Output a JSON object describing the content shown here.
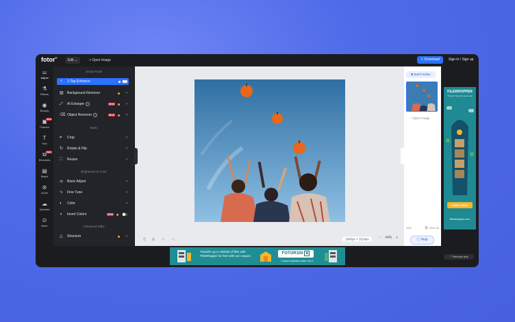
{
  "topbar": {
    "logo": "fotor",
    "edit_label": "Edit ⌄",
    "open_image_label": "+  Open Image",
    "download_label": "⇩ Download",
    "signin_label": "Sign in / Sign up"
  },
  "rail": {
    "items": [
      {
        "label": "Adjust",
        "icon": "sliders-icon"
      },
      {
        "label": "Effects",
        "icon": "flask-icon"
      },
      {
        "label": "Beauty",
        "icon": "eye-icon"
      },
      {
        "label": "Frames",
        "icon": "frame-icon",
        "badge": "NEW"
      },
      {
        "label": "Text",
        "icon": "text-icon"
      },
      {
        "label": "Elements",
        "icon": "elements-icon",
        "badge": "NEW"
      },
      {
        "label": "Batch",
        "icon": "batch-icon"
      },
      {
        "label": "AI Art",
        "icon": "ai-art-icon"
      },
      {
        "label": "Uploads",
        "icon": "cloud-upload-icon"
      },
      {
        "label": "More",
        "icon": "more-icon"
      }
    ]
  },
  "panel": {
    "smart_tools_title": "Smart Tools",
    "basic_title": "Basic",
    "brightness_title": "Brightness & Color",
    "advanced_title": "Advanced Edits",
    "smart_tools": [
      {
        "label": "1-Tap Enhance"
      },
      {
        "label": "Background Remover"
      },
      {
        "label": "AI Enlarger",
        "tag": "NEW"
      },
      {
        "label": "Object Remover",
        "tag": "NEW"
      }
    ],
    "basic": [
      {
        "label": "Crop"
      },
      {
        "label": "Rotate & Flip"
      },
      {
        "label": "Resize"
      }
    ],
    "brightness": [
      {
        "label": "Basic Adjust"
      },
      {
        "label": "Fine Tune"
      },
      {
        "label": "Color"
      },
      {
        "label": "Invert Colors",
        "tag": "NEW"
      }
    ],
    "advanced": [
      {
        "label": "Structure"
      }
    ]
  },
  "canvas": {
    "dimensions": "1080px × 1024px",
    "zoom_value": "44%",
    "zoom_minus": "−",
    "zoom_plus": "+"
  },
  "right_panel": {
    "batch_editor": "⧉ Batch Editor",
    "open_image": "+  Open Image",
    "count": "1/50",
    "clear_all": "🗑 Clear All",
    "help": "ⓘ Help"
  },
  "right_ad": {
    "title": "FILEWHOPPER",
    "subtitle": "Transfer files the smart way",
    "button": "Learn more",
    "url": "filewhopper.com"
  },
  "bottom_ad": {
    "text": "Transfer up to 200GB of files with FileWhopper for free with our coupon",
    "code": "FOTOR100",
    "expiration": "Coupon expiration date: July 1"
  },
  "remove_ads": "♡ Remove ads",
  "colors": {
    "accent": "#2b72ff",
    "background": "#4f6be8",
    "app_dark": "#1b1c20",
    "ad_teal": "#1f8d94",
    "new_badge": "#e8384f"
  }
}
